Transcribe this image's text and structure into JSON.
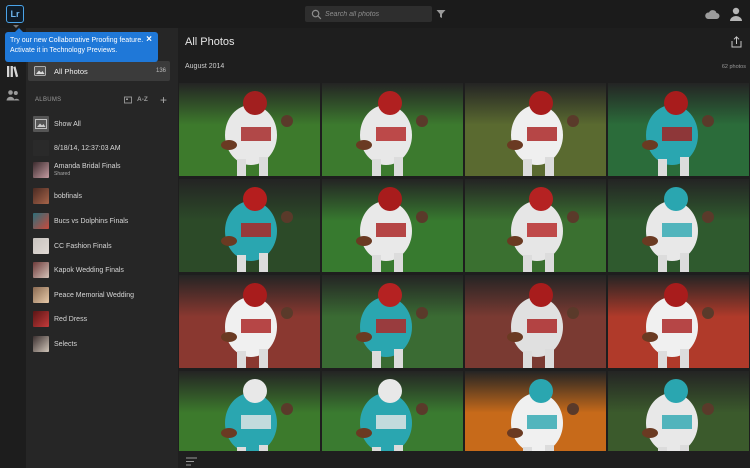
{
  "app": {
    "logo_text": "Lr"
  },
  "search": {
    "placeholder": "Search all photos"
  },
  "icons": {
    "search": "search-icon",
    "filter": "filter-icon",
    "cloud": "cloud-icon",
    "user": "user-icon",
    "library": "library-icon",
    "people": "people-icon",
    "share": "share-icon",
    "sort": "sort-icon"
  },
  "colors": {
    "accent": "#1f78d8",
    "panel": "#262626",
    "selected": "#3b3b3b",
    "main": "#1e1e1e"
  },
  "tooltip": {
    "line1": "Try our new Collaborative Proofing feature.",
    "line2": "Activate it in Technology Previews.",
    "close": "×"
  },
  "sidebar": {
    "all_photos": {
      "label": "All Photos",
      "count": "136"
    },
    "albums_title": "ALBUMS",
    "albums_sort": "A-Z",
    "albums": [
      {
        "label": "Show All",
        "sub": ""
      },
      {
        "label": "8/18/14, 12:37:03 AM",
        "sub": ""
      },
      {
        "label": "Amanda Bridal Finals",
        "sub": "Shared"
      },
      {
        "label": "bobfinals",
        "sub": ""
      },
      {
        "label": "Bucs vs Dolphins Finals",
        "sub": ""
      },
      {
        "label": "CC Fashion Finals",
        "sub": ""
      },
      {
        "label": "Kapok Wedding Finals",
        "sub": ""
      },
      {
        "label": "Peace Memorial Wedding",
        "sub": ""
      },
      {
        "label": "Red Dress",
        "sub": ""
      },
      {
        "label": "Selects",
        "sub": ""
      }
    ]
  },
  "main": {
    "title": "All Photos",
    "date": "August 2014",
    "count": "62 photos"
  }
}
